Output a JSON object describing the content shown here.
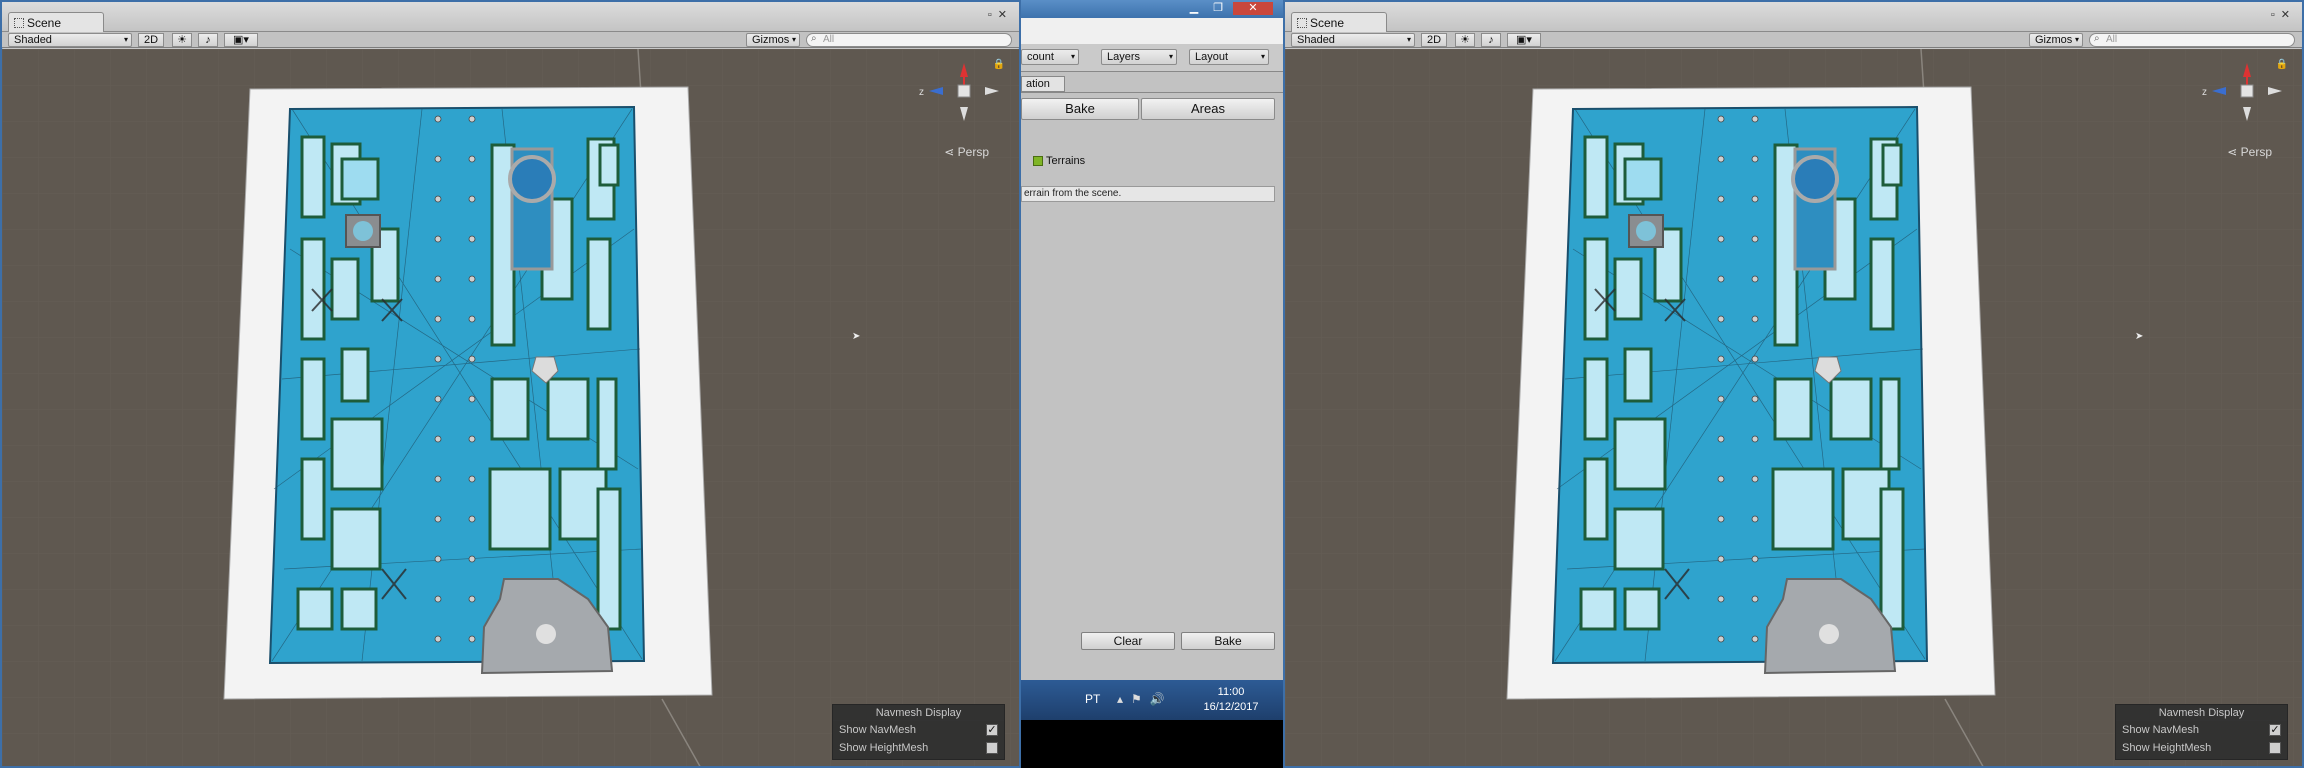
{
  "left_window": {
    "tab_label": "Scene",
    "toolbar": {
      "shading": "Shaded",
      "mode_2d": "2D",
      "gizmos": "Gizmos",
      "search_placeholder": "All"
    },
    "projection": "Persp",
    "axis_z": "z",
    "navmesh_panel": {
      "title": "Navmesh Display",
      "show_navmesh": "Show NavMesh",
      "show_heightmesh": "Show HeightMesh",
      "navmesh_checked": true,
      "heightmesh_checked": false
    }
  },
  "right_window": {
    "tab_label": "Scene",
    "toolbar": {
      "shading": "Shaded",
      "mode_2d": "2D",
      "gizmos": "Gizmos",
      "search_placeholder": "All"
    },
    "projection": "Persp",
    "axis_z": "z",
    "navmesh_panel": {
      "title": "Navmesh Display",
      "show_navmesh": "Show NavMesh",
      "show_heightmesh": "Show HeightMesh",
      "navmesh_checked": true,
      "heightmesh_checked": false
    }
  },
  "middle_window": {
    "account_dropdown": "count",
    "layers_dropdown": "Layers",
    "layout_dropdown": "Layout",
    "tab_label": "ation",
    "bake_tab": "Bake",
    "areas_tab": "Areas",
    "terrains_label": "Terrains",
    "hint_text": "errain from the scene.",
    "clear_button": "Clear",
    "bake_button": "Bake"
  },
  "taskbar": {
    "language": "PT",
    "time": "11:00",
    "date": "16/12/2017"
  },
  "colors": {
    "viewport_bg": "#5f5850",
    "navmesh": "#3aa6cf",
    "walls": "#2a5d35",
    "title_bar": "#3d72ad"
  }
}
